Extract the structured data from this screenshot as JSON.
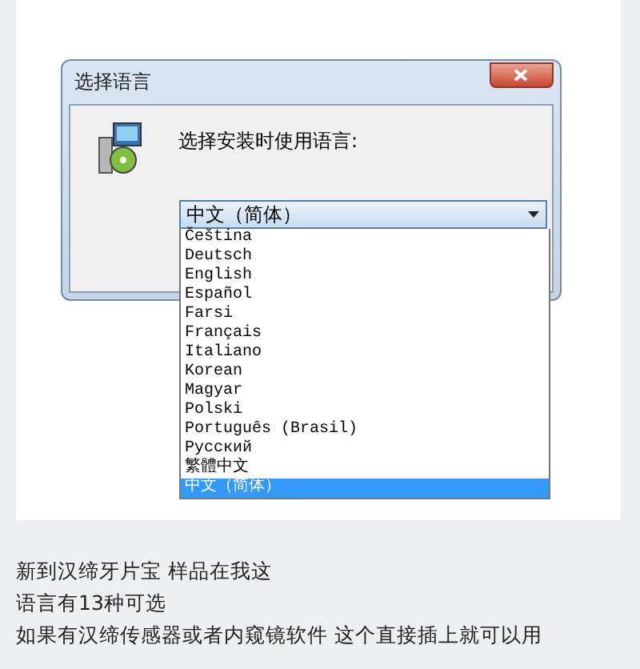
{
  "dialog": {
    "title": "选择语言",
    "prompt": "选择安装时使用语言:",
    "combo": {
      "value": "中文（简体）",
      "expanded": true
    },
    "options": [
      {
        "label": "Čeština",
        "selected": false
      },
      {
        "label": "Deutsch",
        "selected": false
      },
      {
        "label": "English",
        "selected": false
      },
      {
        "label": "Español",
        "selected": false
      },
      {
        "label": "Farsi",
        "selected": false
      },
      {
        "label": "Français",
        "selected": false
      },
      {
        "label": "Italiano",
        "selected": false
      },
      {
        "label": "Korean",
        "selected": false
      },
      {
        "label": "Magyar",
        "selected": false
      },
      {
        "label": "Polski",
        "selected": false
      },
      {
        "label": "Português (Brasil)",
        "selected": false
      },
      {
        "label": "Русский",
        "selected": false
      },
      {
        "label": "繁體中文",
        "selected": false
      },
      {
        "label": "中文（简体）",
        "selected": true
      }
    ]
  },
  "caption": [
    "新到汉缔牙片宝 样品在我这",
    "语言有13种可选",
    "如果有汉缔传感器或者内窥镜软件 这个直接插上就可以用"
  ]
}
